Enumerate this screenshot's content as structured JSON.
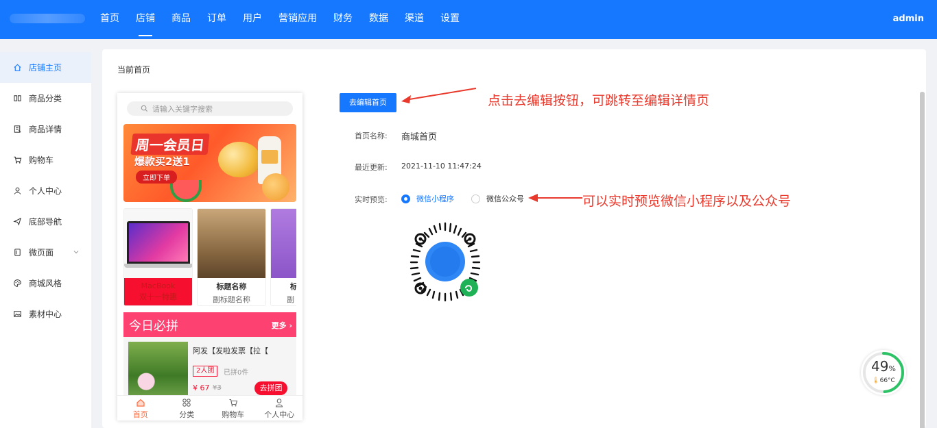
{
  "topnav": {
    "items": [
      "首页",
      "店铺",
      "商品",
      "订单",
      "用户",
      "营销应用",
      "财务",
      "数据",
      "渠道",
      "设置"
    ],
    "active_index": 1,
    "user": "admin"
  },
  "sidebar": {
    "items": [
      {
        "label": "店铺主页",
        "icon": "home-icon",
        "active": true
      },
      {
        "label": "商品分类",
        "icon": "category-icon"
      },
      {
        "label": "商品详情",
        "icon": "detail-icon"
      },
      {
        "label": "购物车",
        "icon": "cart-icon"
      },
      {
        "label": "个人中心",
        "icon": "user-icon"
      },
      {
        "label": "底部导航",
        "icon": "send-icon"
      },
      {
        "label": "微页面",
        "icon": "page-icon",
        "has_submenu": true
      },
      {
        "label": "商城风格",
        "icon": "palette-icon"
      },
      {
        "label": "素材中心",
        "icon": "image-icon"
      }
    ]
  },
  "main": {
    "title": "当前首页",
    "edit_button": "去编辑首页",
    "name_label": "首页名称:",
    "name_value": "商城首页",
    "updated_label": "最近更新:",
    "updated_value": "2021-11-10 11:47:24",
    "preview_label": "实时预览:",
    "preview_options": [
      "微信小程序",
      "微信公众号"
    ],
    "preview_selected": 0,
    "annotation_edit": "点击去编辑按钮，可跳转至编辑详情页",
    "annotation_preview": "可以实时预览微信小程序以及公众号"
  },
  "phone": {
    "search_placeholder": "请输入关键字搜索",
    "banner": {
      "line1": "周一会员日",
      "line2": "爆款买2送1",
      "button": "立即下单"
    },
    "products": [
      {
        "title": "MacBook",
        "subtitle": "双十一特惠"
      },
      {
        "title": "标题名称",
        "subtitle": "副标题名称"
      },
      {
        "title": "标",
        "subtitle": "副"
      }
    ],
    "group_buy": {
      "title": "今日必拼",
      "more": "更多",
      "item_name": "阿发【发啦发票【拉【",
      "tag": "2人团",
      "sold": "已拼0件",
      "price": "¥ 67",
      "old_price": "¥3",
      "button": "去拼团"
    },
    "tabbar": [
      "首页",
      "分类",
      "购物车",
      "个人中心"
    ],
    "tabbar_active": 0
  },
  "widget": {
    "percent": "49",
    "percent_unit": "%",
    "temp": "66°C",
    "level": 0.49
  },
  "colors": {
    "primary": "#1677ff",
    "accent_red": "#e8392c",
    "pin_pink": "#fd4171"
  }
}
